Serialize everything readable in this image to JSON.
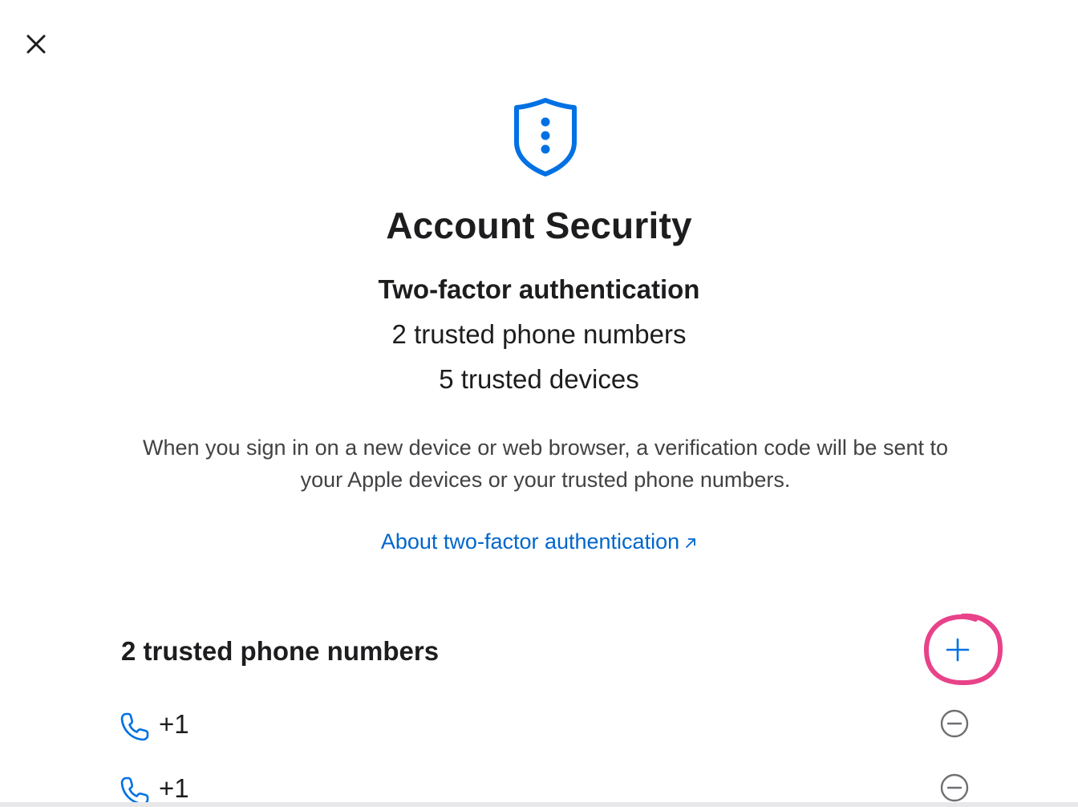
{
  "header": {
    "close_icon": "close-icon"
  },
  "hero": {
    "icon": "shield-ellipsis-icon",
    "title": "Account Security"
  },
  "summary": {
    "heading": "Two-factor authentication",
    "phone_count_text": "2 trusted phone numbers",
    "device_count_text": "5 trusted devices"
  },
  "description": "When you sign in on a new device or web browser, a verification code will be sent to your Apple devices or your trusted phone numbers.",
  "about_link": {
    "label": "About two-factor authentication",
    "icon": "external-arrow-icon"
  },
  "phones_section": {
    "heading": "2 trusted phone numbers",
    "add_icon": "plus-icon",
    "items": [
      {
        "icon": "phone-icon",
        "number": "+1",
        "remove_icon": "minus-circle-icon"
      },
      {
        "icon": "phone-icon",
        "number": "+1",
        "remove_icon": "minus-circle-icon"
      }
    ]
  },
  "colors": {
    "accent": "#0071e3",
    "link": "#0066cc",
    "text_primary": "#1d1d1f",
    "text_secondary": "#424245",
    "icon_gray": "#6e6e73",
    "highlight_annotation": "#e8428a"
  }
}
